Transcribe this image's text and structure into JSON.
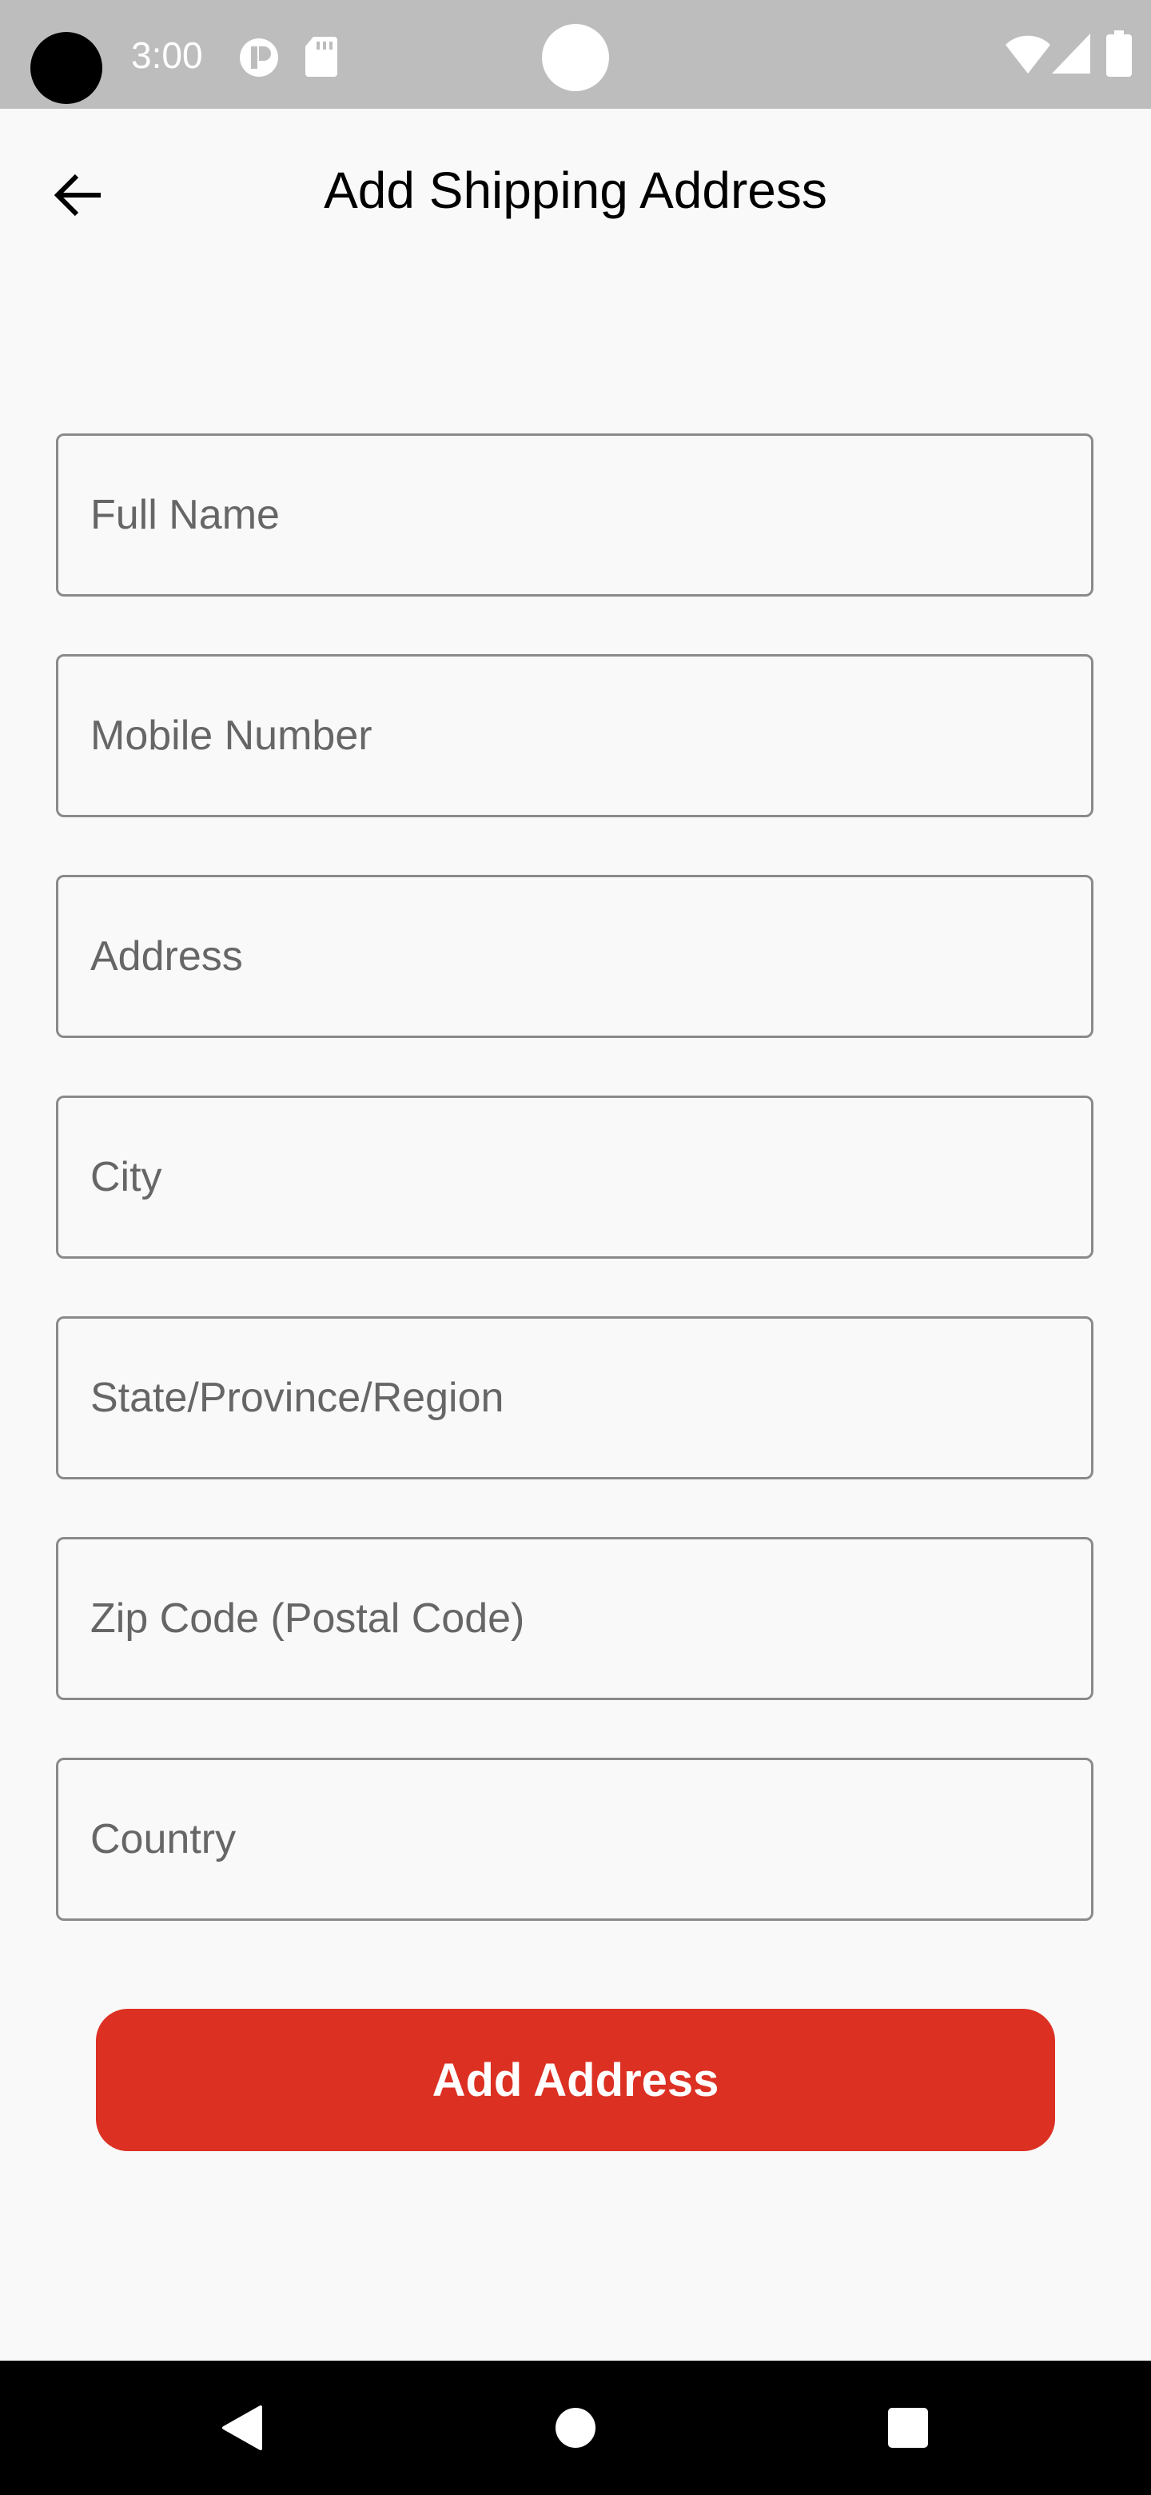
{
  "status_bar": {
    "time": "3:00",
    "icons": [
      "camera-hole-icon",
      "notification-icon",
      "sd-card-icon",
      "wifi-icon",
      "signal-icon",
      "battery-icon"
    ]
  },
  "app_bar": {
    "back_icon": "arrow-left-icon",
    "title": "Add Shipping Address"
  },
  "form": {
    "fields": [
      {
        "name": "full-name-field",
        "placeholder": "Full Name",
        "value": ""
      },
      {
        "name": "mobile-number-field",
        "placeholder": "Mobile Number",
        "value": ""
      },
      {
        "name": "address-field",
        "placeholder": "Address",
        "value": ""
      },
      {
        "name": "city-field",
        "placeholder": "City",
        "value": ""
      },
      {
        "name": "state-field",
        "placeholder": "State/Province/Region",
        "value": ""
      },
      {
        "name": "zip-code-field",
        "placeholder": "Zip Code (Postal Code)",
        "value": ""
      },
      {
        "name": "country-field",
        "placeholder": "Country",
        "value": ""
      }
    ],
    "submit_label": "Add Address"
  },
  "nav_bar": {
    "icons": [
      "back-triangle-icon",
      "home-circle-icon",
      "recents-square-icon"
    ]
  },
  "colors": {
    "accent": "#dc3023",
    "background": "#f9f9f9",
    "status_bar": "#bdbdbd",
    "field_border": "#8a8a8a"
  }
}
